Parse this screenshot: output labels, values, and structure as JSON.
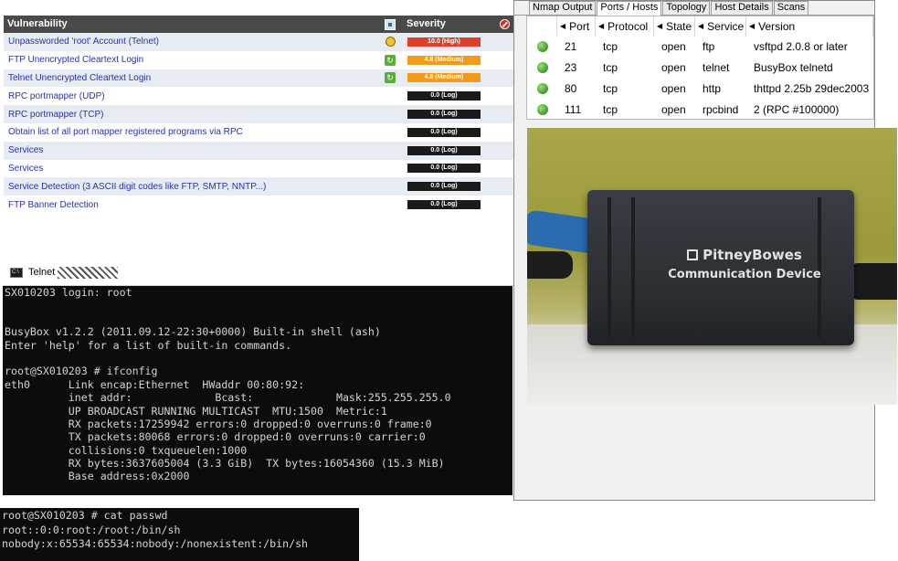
{
  "vuln_panel": {
    "header": {
      "col_name": "Vulnerability",
      "col_severity": "Severity"
    },
    "rows": [
      {
        "name": "Unpassworded 'root' Account (Telnet)",
        "icon": "lock-icon",
        "severity": "10.0 (High)",
        "level": "high"
      },
      {
        "name": "FTP Unencrypted Cleartext Login",
        "icon": "refresh-icon",
        "severity": "4.8 (Medium)",
        "level": "medium"
      },
      {
        "name": "Telnet Unencrypted Cleartext Login",
        "icon": "refresh-icon",
        "severity": "4.8 (Medium)",
        "level": "medium"
      },
      {
        "name": "RPC portmapper (UDP)",
        "icon": "",
        "severity": "0.0 (Log)",
        "level": "log"
      },
      {
        "name": "RPC portmapper (TCP)",
        "icon": "",
        "severity": "0.0 (Log)",
        "level": "log"
      },
      {
        "name": "Obtain list of all port mapper registered programs via RPC",
        "icon": "",
        "severity": "0.0 (Log)",
        "level": "log"
      },
      {
        "name": "Services",
        "icon": "",
        "severity": "0.0 (Log)",
        "level": "log"
      },
      {
        "name": "Services",
        "icon": "",
        "severity": "0.0 (Log)",
        "level": "log"
      },
      {
        "name": "Service Detection (3 ASCII digit codes like FTP, SMTP, NNTP...)",
        "icon": "",
        "severity": "0.0 (Log)",
        "level": "log"
      },
      {
        "name": "FTP Banner Detection",
        "icon": "",
        "severity": "0.0 (Log)",
        "level": "log"
      }
    ],
    "colors": {
      "high": "#e0402a",
      "medium": "#f29a1a",
      "log": "#1a1a1a",
      "link": "#2730b8"
    }
  },
  "telnet": {
    "title": "Telnet",
    "lines": [
      "SX010203 login: root",
      "",
      "",
      "BusyBox v1.2.2 (2011.09.12-22:30+0000) Built-in shell (ash)",
      "Enter 'help' for a list of built-in commands.",
      "",
      "root@SX010203 # ifconfig",
      "eth0      Link encap:Ethernet  HWaddr 00:80:92:",
      "          inet addr:             Bcast:             Mask:255.255.255.0",
      "          UP BROADCAST RUNNING MULTICAST  MTU:1500  Metric:1",
      "          RX packets:17259942 errors:0 dropped:0 overruns:0 frame:0",
      "          TX packets:80068 errors:0 dropped:0 overruns:0 carrier:0",
      "          collisions:0 txqueuelen:1000",
      "          RX bytes:3637605004 (3.3 GiB)  TX bytes:16054360 (15.3 MiB)",
      "          Base address:0x2000"
    ]
  },
  "passwd_terminal": {
    "lines": [
      "root@SX010203 # cat passwd",
      "root::0:0:root:/root:/bin/sh",
      "nobody:x:65534:65534:nobody:/nonexistent:/bin/sh"
    ]
  },
  "nmap": {
    "tabs": [
      "Nmap Output",
      "Ports / Hosts",
      "Topology",
      "Host Details",
      "Scans"
    ],
    "active_tab": "Ports / Hosts",
    "columns": [
      "Port",
      "Protocol",
      "State",
      "Service",
      "Version"
    ],
    "rows": [
      {
        "port": "21",
        "protocol": "tcp",
        "state": "open",
        "service": "ftp",
        "version": "vsftpd 2.0.8 or later"
      },
      {
        "port": "23",
        "protocol": "tcp",
        "state": "open",
        "service": "telnet",
        "version": "BusyBox telnetd"
      },
      {
        "port": "80",
        "protocol": "tcp",
        "state": "open",
        "service": "http",
        "version": "thttpd 2.25b 29dec2003"
      },
      {
        "port": "111",
        "protocol": "tcp",
        "state": "open",
        "service": "rpcbind",
        "version": "2 (RPC #100000)"
      }
    ]
  },
  "device_photo": {
    "brand": "PitneyBowes",
    "label": "Communication Device"
  }
}
